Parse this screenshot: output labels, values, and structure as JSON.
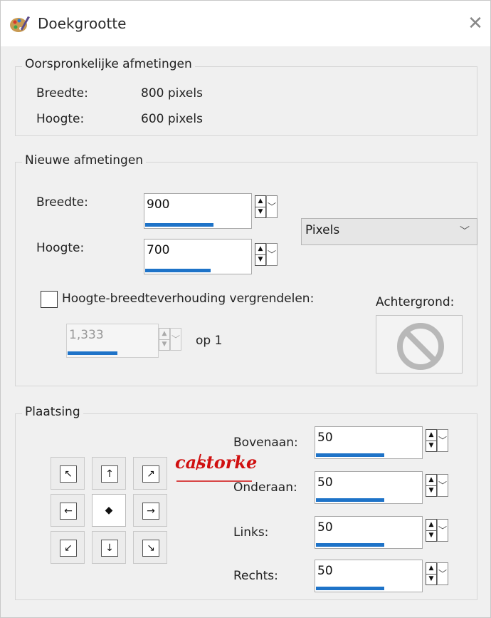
{
  "dialog": {
    "title": "Doekgrootte",
    "icon": "paint-palette-icon",
    "close_icon": "close-icon"
  },
  "original_size": {
    "title": "Oorspronkelijke afmetingen",
    "width_label": "Breedte:",
    "width_value": "800 pixels",
    "height_label": "Hoogte:",
    "height_value": "600 pixels"
  },
  "new_size": {
    "title": "Nieuwe afmetingen",
    "width_label": "Breedte:",
    "width_value": "900",
    "height_label": "Hoogte:",
    "height_value": "700",
    "unit_value": "Pixels",
    "lock_ratio_label": "Hoogte-breedteverhouding vergrendelen:",
    "lock_ratio_checked": false,
    "ratio_value": "1,333",
    "ratio_suffix": "op 1",
    "background_label": "Achtergrond:",
    "background_icon": "no-symbol-icon"
  },
  "placement": {
    "title": "Plaatsing",
    "top_label": "Bovenaan:",
    "top_value": "50",
    "bottom_label": "Onderaan:",
    "bottom_value": "50",
    "left_label": "Links:",
    "left_value": "50",
    "right_label": "Rechts:",
    "right_value": "50",
    "anchor_selected": "center",
    "anchor_icons": [
      "arrow-up-left-icon",
      "arrow-up-icon",
      "arrow-up-right-icon",
      "arrow-left-icon",
      "center-dot-icon",
      "arrow-right-icon",
      "arrow-down-left-icon",
      "arrow-down-icon",
      "arrow-down-right-icon"
    ]
  },
  "watermark": {
    "text": "castorke"
  },
  "colors": {
    "accent_bar": "#1e73c8",
    "watermark": "#d01010"
  }
}
